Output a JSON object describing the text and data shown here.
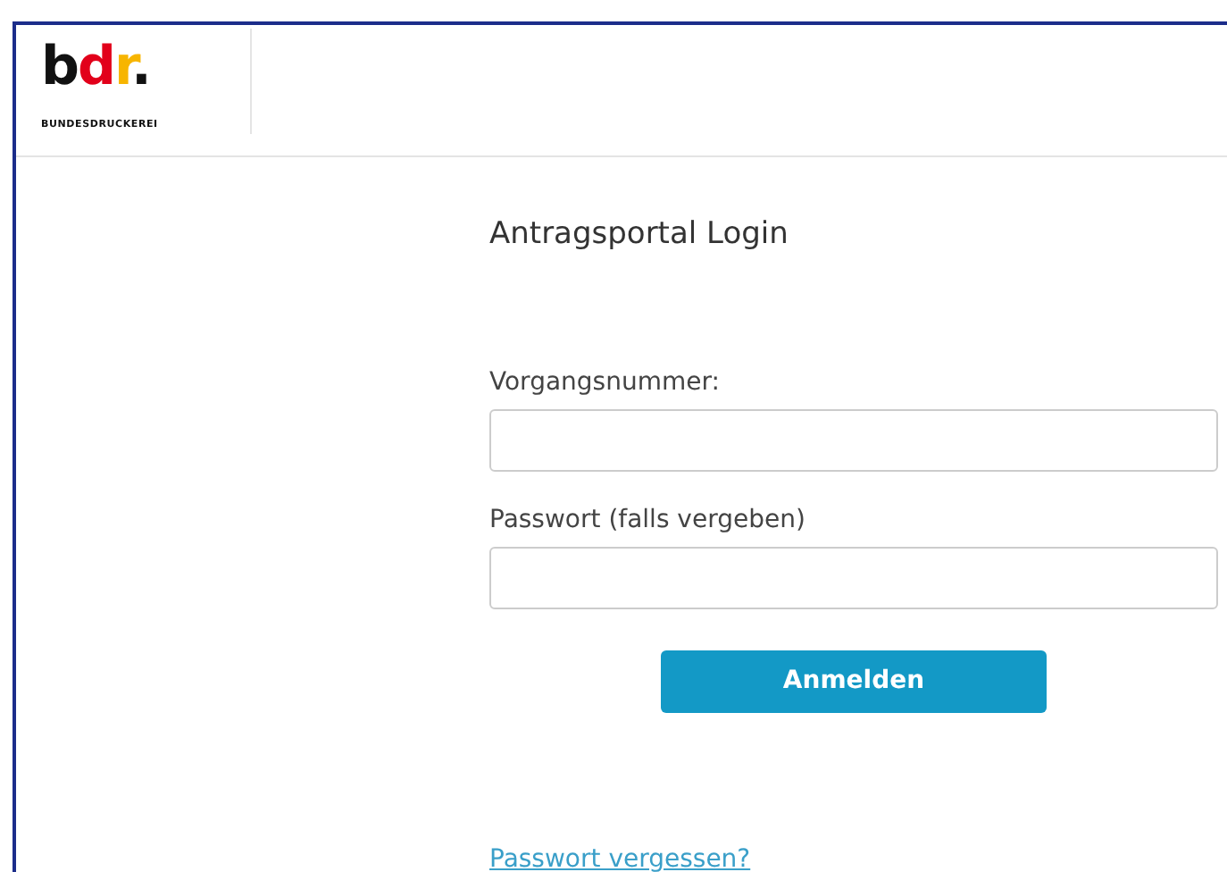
{
  "header": {
    "logo": [
      {
        "text": "b",
        "color": "#111111"
      },
      {
        "text": "d",
        "color": "#e2001a"
      },
      {
        "text": "r",
        "color": "#f7b500"
      },
      {
        "text": ".",
        "color": "#111111"
      }
    ],
    "logo_tagline": "BUNDESDRUCKEREI"
  },
  "login": {
    "title": "Antragsportal Login",
    "fields": [
      {
        "label": "Vorgangsnummer:"
      },
      {
        "label": "Passwort (falls vergeben)"
      }
    ],
    "submit": "Anmelden",
    "forgot_link": "Passwort vergessen?"
  }
}
